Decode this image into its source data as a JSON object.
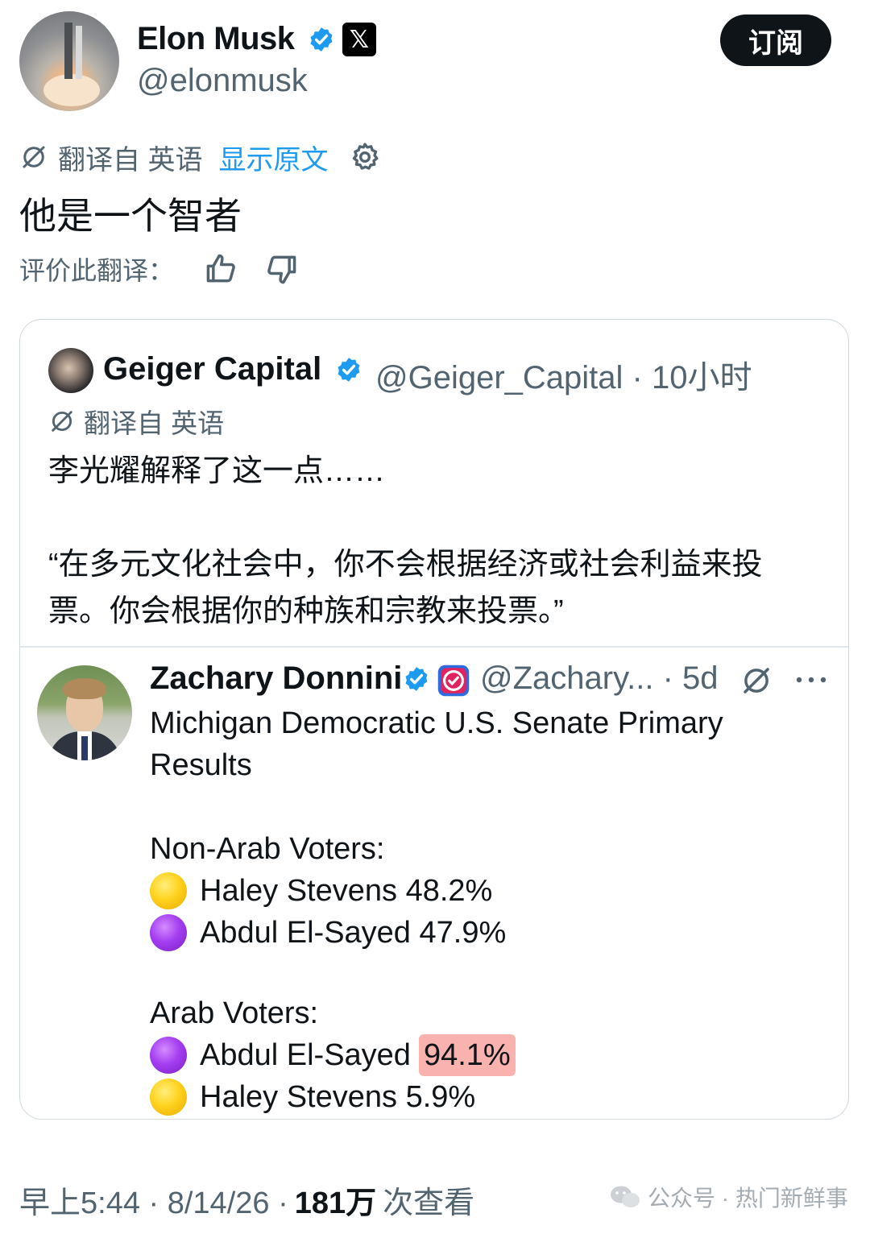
{
  "author": {
    "name": "Elon Musk",
    "handle": "@elonmusk",
    "x_badge": "𝕏",
    "subscribe_label": "订阅"
  },
  "translation_bar": {
    "translated_from": "翻译自 英语",
    "show_original": "显示原文"
  },
  "post_text": "他是一个智者",
  "rate_translation": {
    "label": "评价此翻译："
  },
  "quoted": {
    "name": "Geiger Capital",
    "handle_time": "@Geiger_Capital · 10小时",
    "translated_from": "翻译自 英语",
    "text": "李光耀解释了这一点……\n\n“在多元文化社会中，你不会根据经济或社会利益来投票。你会根据你的种族和宗教来投票。”",
    "inner": {
      "name": "Zachary Donnini",
      "handle_time": "@Zachary... · 5d",
      "title": "Michigan Democratic U.S. Senate Primary Results",
      "group1_label": "Non-Arab Voters:",
      "group1": [
        {
          "color": "yellow",
          "text": "Haley Stevens 48.2%"
        },
        {
          "color": "purple",
          "text": "Abdul El-Sayed 47.9%"
        }
      ],
      "group2_label": "Arab Voters:",
      "group2_line1_name": "Abdul El-Sayed",
      "group2_line1_value": "94.1%",
      "group2_line2": "Haley Stevens 5.9%"
    }
  },
  "footer": {
    "time": "早上5:44 · 8/14/26 ·",
    "views_count": "181万",
    "views_label": "次查看"
  },
  "watermark": "公众号 · 热门新鲜事",
  "colors": {
    "accent": "#1d9bf0",
    "text": "#0f1419",
    "muted": "#536471",
    "highlight": "#f9b2ad"
  }
}
